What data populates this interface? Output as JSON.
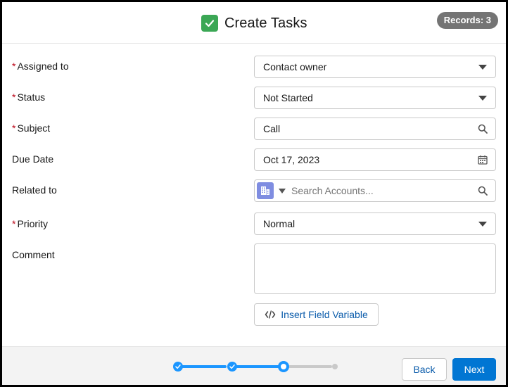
{
  "header": {
    "title": "Create Tasks",
    "records_badge": "Records: 3"
  },
  "form": {
    "assigned_to": {
      "label": "Assigned to",
      "required": true,
      "value": "Contact owner"
    },
    "status": {
      "label": "Status",
      "required": true,
      "value": "Not Started"
    },
    "subject": {
      "label": "Subject",
      "required": true,
      "value": "Call"
    },
    "due_date": {
      "label": "Due Date",
      "required": false,
      "value": "Oct 17, 2023"
    },
    "related_to": {
      "label": "Related to",
      "required": false,
      "placeholder": "Search Accounts..."
    },
    "priority": {
      "label": "Priority",
      "required": true,
      "value": "Normal"
    },
    "comment": {
      "label": "Comment",
      "required": false,
      "value": ""
    },
    "required_marker": "*",
    "insert_field_variable_label": "Insert Field Variable"
  },
  "footer": {
    "back_label": "Back",
    "next_label": "Next",
    "progress": {
      "total_steps": 4,
      "current_step": 3
    }
  },
  "colors": {
    "brand_blue": "#0176d3",
    "progress_blue": "#1b96ff",
    "required_red": "#ba0517",
    "success_green": "#3ba755",
    "badge_gray": "#747474",
    "account_icon": "#7f8de1"
  },
  "icons": {
    "title": "check-icon",
    "dropdown": "caret-down-icon",
    "search": "search-icon",
    "calendar": "calendar-icon",
    "account": "account-building-icon",
    "code": "code-icon"
  }
}
